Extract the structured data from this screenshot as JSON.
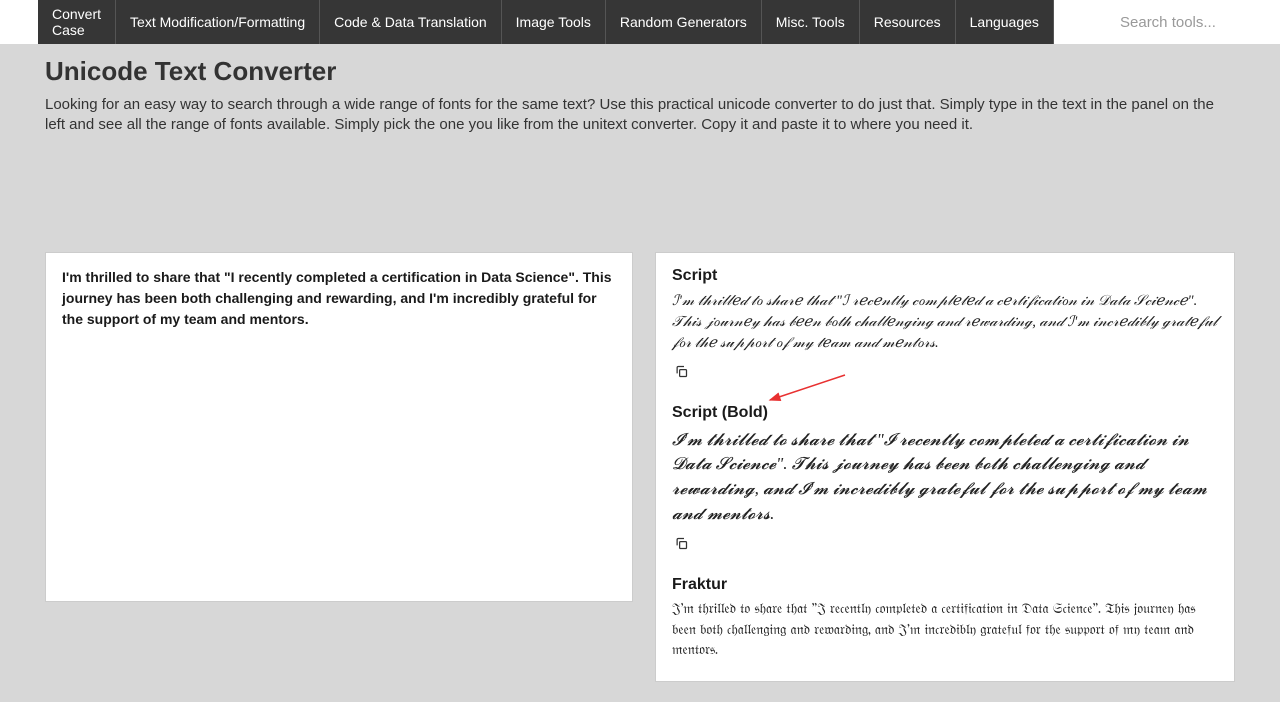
{
  "nav": {
    "items": [
      {
        "line1": "Convert",
        "line2": "Case"
      },
      {
        "label": "Text Modification/Formatting"
      },
      {
        "label": "Code & Data Translation"
      },
      {
        "label": "Image Tools"
      },
      {
        "label": "Random Generators"
      },
      {
        "label": "Misc. Tools"
      },
      {
        "label": "Resources"
      },
      {
        "label": "Languages"
      }
    ]
  },
  "search": {
    "placeholder": "Search tools..."
  },
  "header": {
    "title": "Unicode Text Converter",
    "description": "Looking for an easy way to search through a wide range of fonts for the same text? Use this practical unicode converter to do just that. Simply type in the text in the panel on the left and see all the range of fonts available. Simply pick the one you like from the unitext converter. Copy it and paste it to where you need it."
  },
  "input": {
    "text": "I'm thrilled to share that \"I recently completed a certification in Data Science\". This journey has been both challenging and rewarding, and I'm incredibly grateful for the support of my team and mentors."
  },
  "outputs": [
    {
      "label": "Script",
      "text": "ℐ'𝓂 𝓉𝒽𝓇𝒾𝓁𝓁ℯ𝒹 𝓉ℴ 𝓈𝒽𝒶𝓇ℯ 𝓉𝒽𝒶𝓉 \"ℐ 𝓇ℯ𝒸ℯ𝓃𝓉𝓁𝓎 𝒸ℴ𝓂𝓅𝓁ℯ𝓉ℯ𝒹 𝒶 𝒸ℯ𝓇𝓉𝒾𝒻𝒾𝒸𝒶𝓉𝒾ℴ𝓃 𝒾𝓃 𝒟𝒶𝓉𝒶 𝒮𝒸𝒾ℯ𝓃𝒸ℯ\". 𝒯𝒽𝒾𝓈 𝒿ℴ𝓊𝓇𝓃ℯ𝓎 𝒽𝒶𝓈 𝒷ℯℯ𝓃 𝒷ℴ𝓉𝒽 𝒸𝒽𝒶𝓁𝓁ℯ𝓃ℊ𝒾𝓃ℊ 𝒶𝓃𝒹 𝓇ℯ𝓌𝒶𝓇𝒹𝒾𝓃ℊ, 𝒶𝓃𝒹 ℐ'𝓂 𝒾𝓃𝒸𝓇ℯ𝒹𝒾𝒷𝓁𝓎 ℊ𝓇𝒶𝓉ℯ𝒻𝓊𝓁 𝒻ℴ𝓇 𝓉𝒽ℯ 𝓈𝓊𝓅𝓅ℴ𝓇𝓉 ℴ𝒻 𝓂𝓎 𝓉ℯ𝒶𝓂 𝒶𝓃𝒹 𝓂ℯ𝓃𝓉ℴ𝓇𝓈."
    },
    {
      "label": "Script (Bold)",
      "text": "𝓘'𝓶 𝓽𝓱𝓻𝓲𝓵𝓵𝓮𝓭 𝓽𝓸 𝓼𝓱𝓪𝓻𝓮 𝓽𝓱𝓪𝓽 \"𝓘 𝓻𝓮𝓬𝓮𝓷𝓽𝓵𝔂 𝓬𝓸𝓶𝓹𝓵𝓮𝓽𝓮𝓭 𝓪 𝓬𝓮𝓻𝓽𝓲𝓯𝓲𝓬𝓪𝓽𝓲𝓸𝓷 𝓲𝓷 𝓓𝓪𝓽𝓪 𝓢𝓬𝓲𝓮𝓷𝓬𝓮\". 𝓣𝓱𝓲𝓼 𝓳𝓸𝓾𝓻𝓷𝓮𝔂 𝓱𝓪𝓼 𝓫𝓮𝓮𝓷 𝓫𝓸𝓽𝓱 𝓬𝓱𝓪𝓵𝓵𝓮𝓷𝓰𝓲𝓷𝓰 𝓪𝓷𝓭 𝓻𝓮𝔀𝓪𝓻𝓭𝓲𝓷𝓰, 𝓪𝓷𝓭 𝓘'𝓶 𝓲𝓷𝓬𝓻𝓮𝓭𝓲𝓫𝓵𝔂 𝓰𝓻𝓪𝓽𝓮𝓯𝓾𝓵 𝓯𝓸𝓻 𝓽𝓱𝓮 𝓼𝓾𝓹𝓹𝓸𝓻𝓽 𝓸𝓯 𝓶𝔂 𝓽𝓮𝓪𝓶 𝓪𝓷𝓭 𝓶𝓮𝓷𝓽𝓸𝓻𝓼."
    },
    {
      "label": "Fraktur",
      "text": "𝔍'𝔪 𝔱𝔥𝔯𝔦𝔩𝔩𝔢𝔡 𝔱𝔬 𝔰𝔥𝔞𝔯𝔢 𝔱𝔥𝔞𝔱 \"𝔍 𝔯𝔢𝔠𝔢𝔫𝔱𝔩𝔶 𝔠𝔬𝔪𝔭𝔩𝔢𝔱𝔢𝔡 𝔞 𝔠𝔢𝔯𝔱𝔦𝔣𝔦𝔠𝔞𝔱𝔦𝔬𝔫 𝔦𝔫 𝔇𝔞𝔱𝔞 𝔖𝔠𝔦𝔢𝔫𝔠𝔢\". 𝔗𝔥𝔦𝔰 𝔧𝔬𝔲𝔯𝔫𝔢𝔶 𝔥𝔞𝔰 𝔟𝔢𝔢𝔫 𝔟𝔬𝔱𝔥 𝔠𝔥𝔞𝔩𝔩𝔢𝔫𝔤𝔦𝔫𝔤 𝔞𝔫𝔡 𝔯𝔢𝔴𝔞𝔯𝔡𝔦𝔫𝔤, 𝔞𝔫𝔡 𝔍'𝔪 𝔦𝔫𝔠𝔯𝔢𝔡𝔦𝔟𝔩𝔶 𝔤𝔯𝔞𝔱𝔢𝔣𝔲𝔩 𝔣𝔬𝔯 𝔱𝔥𝔢 𝔰𝔲𝔭𝔭𝔬𝔯𝔱 𝔬𝔣 𝔪𝔶 𝔱𝔢𝔞𝔪 𝔞𝔫𝔡 𝔪𝔢𝔫𝔱𝔬𝔯𝔰."
    }
  ]
}
